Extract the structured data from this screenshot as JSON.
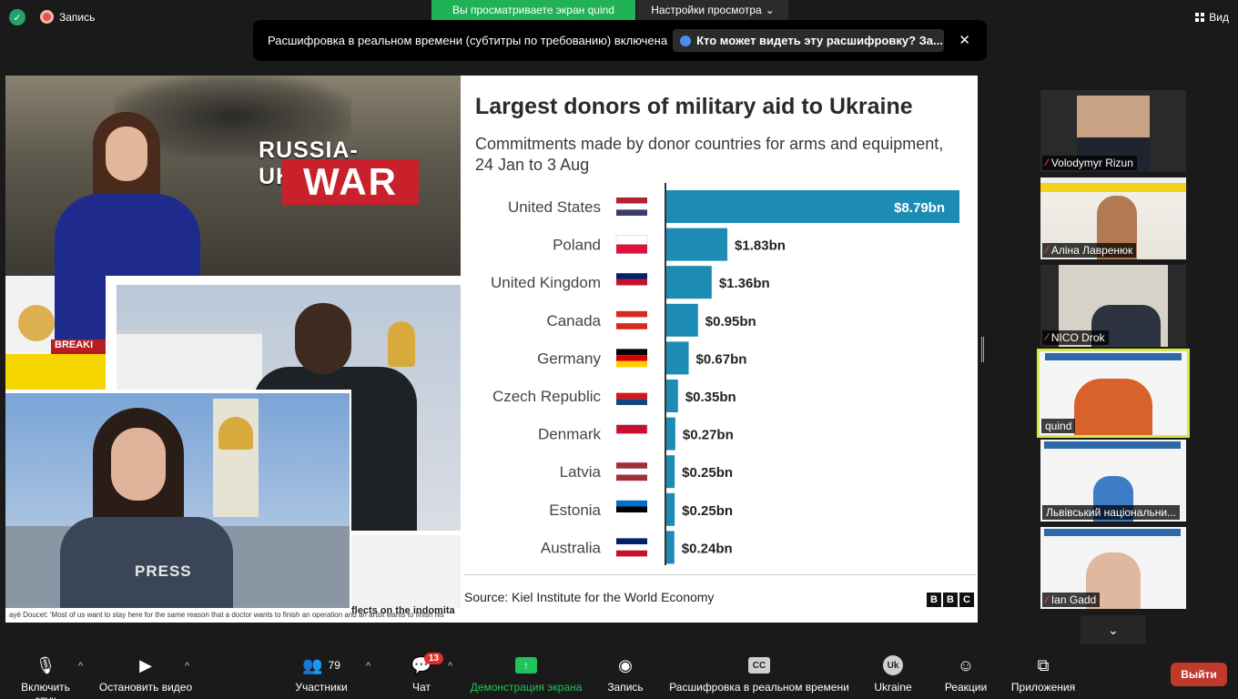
{
  "topbar": {
    "recording_label": "Запись",
    "viewing_banner": "Вы просматриваете экран quind",
    "view_settings": "Настройки просмотра",
    "view_button": "Вид"
  },
  "caption_notice": {
    "text": "Расшифровка в реальном времени (субтитры по требованию) включена",
    "question": "Кто может видеть эту расшифровку? За..."
  },
  "shared_screen": {
    "war_title": "RUSSIA-UKRAINE",
    "war_word": "WAR",
    "breaking": "BREAKI",
    "press": "PRESS",
    "ticker_small": "ayé Doucet: 'Most of us want to stay here for the same reason that a doctor wants to finish an operation and an artist wants to finish his",
    "ticker_bold": "flects on the indomita"
  },
  "chart_data": {
    "type": "bar",
    "orientation": "horizontal",
    "title": "Largest donors of military aid to Ukraine",
    "subtitle": "Commitments made by donor countries for arms and equipment, 24 Jan to 3 Aug",
    "source": "Source: Kiel Institute for the World Economy",
    "categories": [
      "United States",
      "Poland",
      "United Kingdom",
      "Canada",
      "Germany",
      "Czech Republic",
      "Denmark",
      "Latvia",
      "Estonia",
      "Australia"
    ],
    "values": [
      8.79,
      1.83,
      1.36,
      0.95,
      0.67,
      0.35,
      0.27,
      0.25,
      0.25,
      0.24
    ],
    "value_labels": [
      "$8.79bn",
      "$1.83bn",
      "$1.36bn",
      "$0.95bn",
      "$0.67bn",
      "$0.35bn",
      "$0.27bn",
      "$0.25bn",
      "$0.25bn",
      "$0.24bn"
    ],
    "unit": "$bn",
    "bar_color": "#1d8cb4",
    "logo": [
      "B",
      "B",
      "C"
    ]
  },
  "participants": [
    {
      "name": "Volodymyr Rizun",
      "muted": true
    },
    {
      "name": "Аліна Лавренюк",
      "muted": true
    },
    {
      "name": "NICO Drok",
      "muted": true
    },
    {
      "name": "quind",
      "muted": false,
      "active": true
    },
    {
      "name": "Львівський національни...",
      "muted": false
    },
    {
      "name": "Ian Gadd",
      "muted": true
    }
  ],
  "toolbar": {
    "audio": "Включить звук",
    "video": "Остановить видео",
    "participants": "Участники",
    "participants_count": "79",
    "chat": "Чат",
    "chat_badge": "13",
    "share": "Демонстрация экрана",
    "record": "Запись",
    "captions": "Расшифровка в реальном времени",
    "ukraine": "Ukraine",
    "ukraine_icon_text": "Uk",
    "reactions": "Реакции",
    "apps": "Приложения",
    "leave": "Выйти"
  }
}
